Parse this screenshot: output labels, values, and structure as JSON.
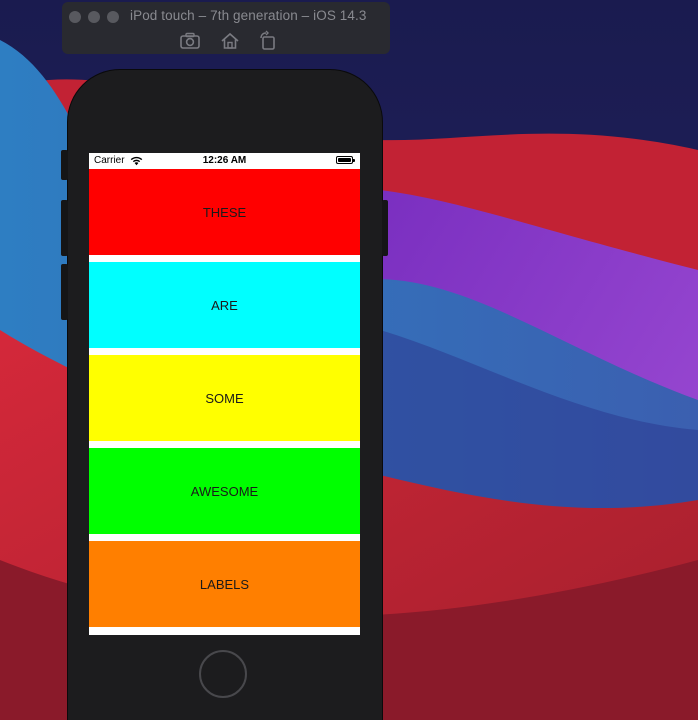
{
  "simulator": {
    "title": "iPod touch – 7th generation – iOS 14.3",
    "toolbar": [
      {
        "name": "screenshot-icon"
      },
      {
        "name": "home-icon"
      },
      {
        "name": "rotate-icon"
      }
    ]
  },
  "status_bar": {
    "carrier": "Carrier",
    "time": "12:26 AM"
  },
  "labels": [
    {
      "text": "THESE",
      "color": "#ff0000"
    },
    {
      "text": "ARE",
      "color": "#00ffff"
    },
    {
      "text": "SOME",
      "color": "#ffff00"
    },
    {
      "text": "AWESOME",
      "color": "#00ff00"
    },
    {
      "text": "LABELS",
      "color": "#ff7f00"
    }
  ],
  "colors": {
    "device_body": "#1c1c1e",
    "wallpaper_red": "#c0262e",
    "wallpaper_blue": "#2f6fb3",
    "wallpaper_purple": "#8c3ec9"
  }
}
